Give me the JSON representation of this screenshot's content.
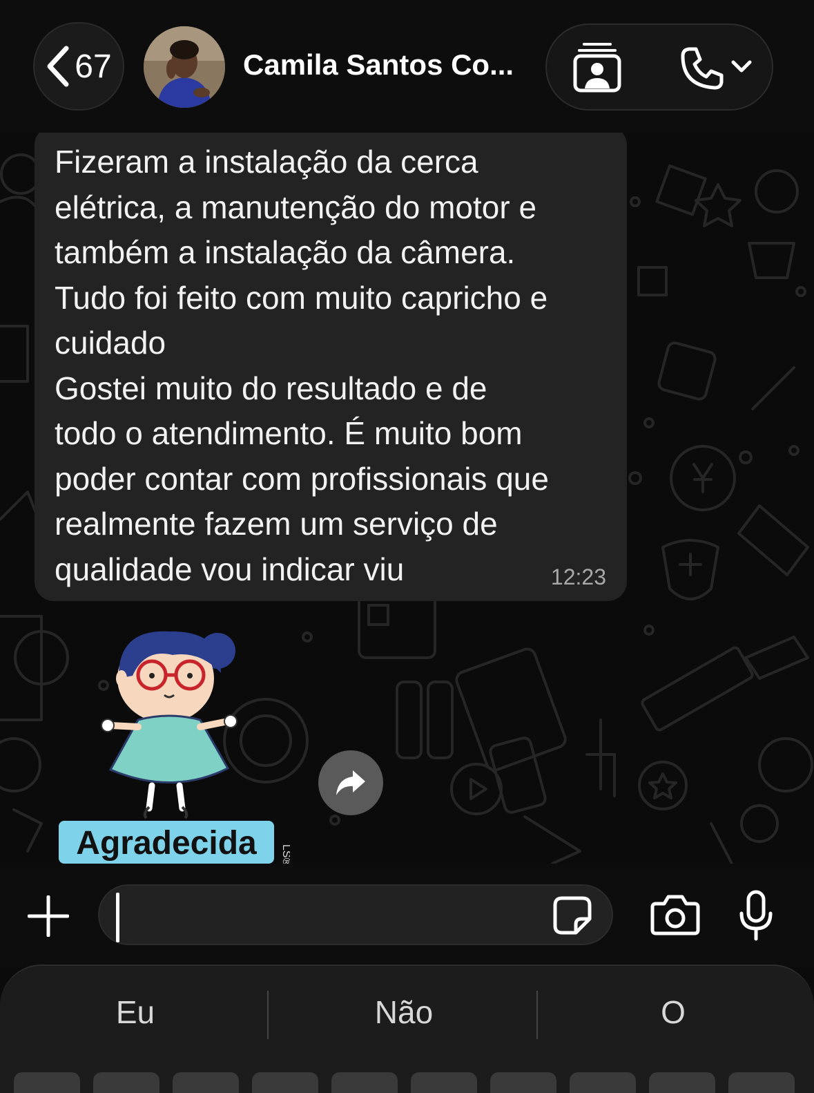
{
  "header": {
    "back_count": "67",
    "contact_name": "Camila Santos Co..."
  },
  "message": {
    "lines": [
      "Fizeram a instalação da cerca",
      "elétrica, a manutenção do motor e",
      "também a instalação da câmera.",
      "Tudo foi feito com muito capricho e",
      "cuidado",
      "Gostei muito do resultado e de",
      "todo o atendimento. É muito bom",
      "poder contar com profissionais que",
      "realmente fazem um serviço de",
      "qualidade vou indicar viu"
    ],
    "time": "12:23"
  },
  "sticker": {
    "caption": "Agradecida",
    "mark": "LS®"
  },
  "keyboard": {
    "suggestions": [
      "Eu",
      "Não",
      "O"
    ]
  },
  "colors": {
    "bubble": "#232323",
    "background": "#0b0b0b",
    "sticker_caption_bg": "#7ed3ea",
    "dress": "#7fd1c5",
    "hair": "#2c3f8f"
  },
  "icons": [
    "back-chevron-icon",
    "contact-card-icon",
    "phone-icon",
    "chevron-down-icon",
    "forward-icon",
    "plus-icon",
    "sticker-icon",
    "camera-icon",
    "microphone-icon"
  ]
}
